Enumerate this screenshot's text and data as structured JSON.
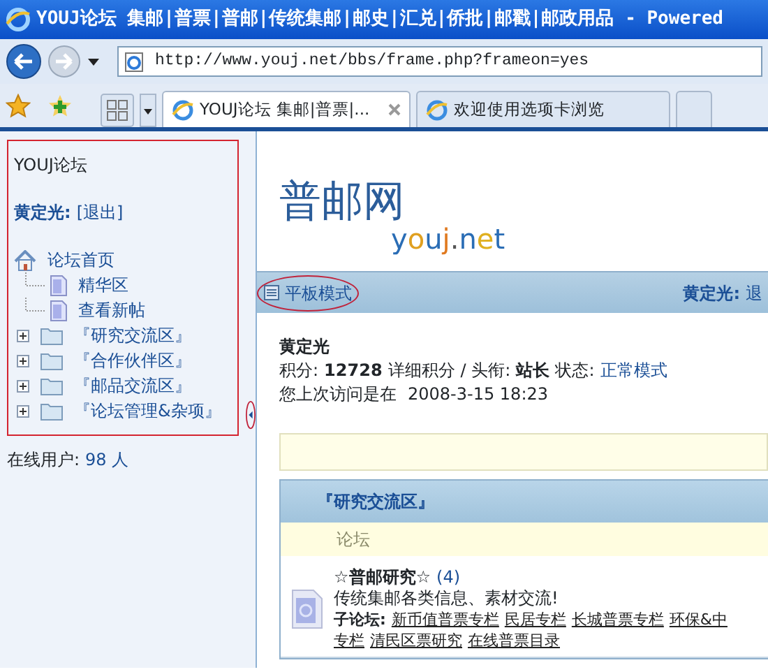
{
  "window": {
    "title": "YOUJ论坛  集邮|普票|普邮|传统集邮|邮史|汇兑|侨批|邮戳|邮政用品 - Powered"
  },
  "browser": {
    "address": "http://www.youj.net/bbs/frame.php?frameon=yes",
    "tabs": [
      {
        "label": "YOUJ论坛  集邮|普票|...",
        "selected": true
      },
      {
        "label": "欢迎使用选项卡浏览",
        "selected": false
      }
    ]
  },
  "sidebar": {
    "forum_name": "YOUJ论坛",
    "user": "黄定光:",
    "logout": "[退出]",
    "tree": [
      {
        "label": "论坛首页",
        "kind": "home",
        "children": [
          {
            "label": "精华区",
            "kind": "page"
          },
          {
            "label": "查看新帖",
            "kind": "page"
          }
        ]
      },
      {
        "label": "『研究交流区』",
        "kind": "folder"
      },
      {
        "label": "『合作伙伴区』",
        "kind": "folder"
      },
      {
        "label": "『邮品交流区』",
        "kind": "folder"
      },
      {
        "label": "『论坛管理&杂项』",
        "kind": "folder"
      }
    ],
    "online_label": "在线用户:",
    "online_count": "98 人"
  },
  "main": {
    "logo_cn": "普邮网",
    "logo_en": "youj.net",
    "toolbar": {
      "mode_link": "平板模式",
      "user": "黄定光:",
      "logout": "退"
    },
    "profile": {
      "name": "黄定光",
      "points_label": "积分:",
      "points": "12728",
      "detail_link": "详细积分",
      "title_label": "/ 头衔:",
      "title": "站长",
      "status_label": "状态:",
      "status": "正常模式",
      "visit_label": "您上次访问是在",
      "visit_time": "2008-3-15 18:23"
    },
    "category": {
      "title": "『研究交流区』",
      "column": "论坛",
      "forums": [
        {
          "name": "☆普邮研究☆",
          "count": "(4)",
          "description": "传统集邮各类信息、素材交流!",
          "sub_label": "子论坛:",
          "sub_lines": [
            [
              "新币值普票专栏",
              "民居专栏",
              "长城普票专栏",
              "环保&中"
            ],
            [
              "专栏",
              "清民区票研究",
              "在线普票目录"
            ]
          ]
        }
      ]
    }
  }
}
